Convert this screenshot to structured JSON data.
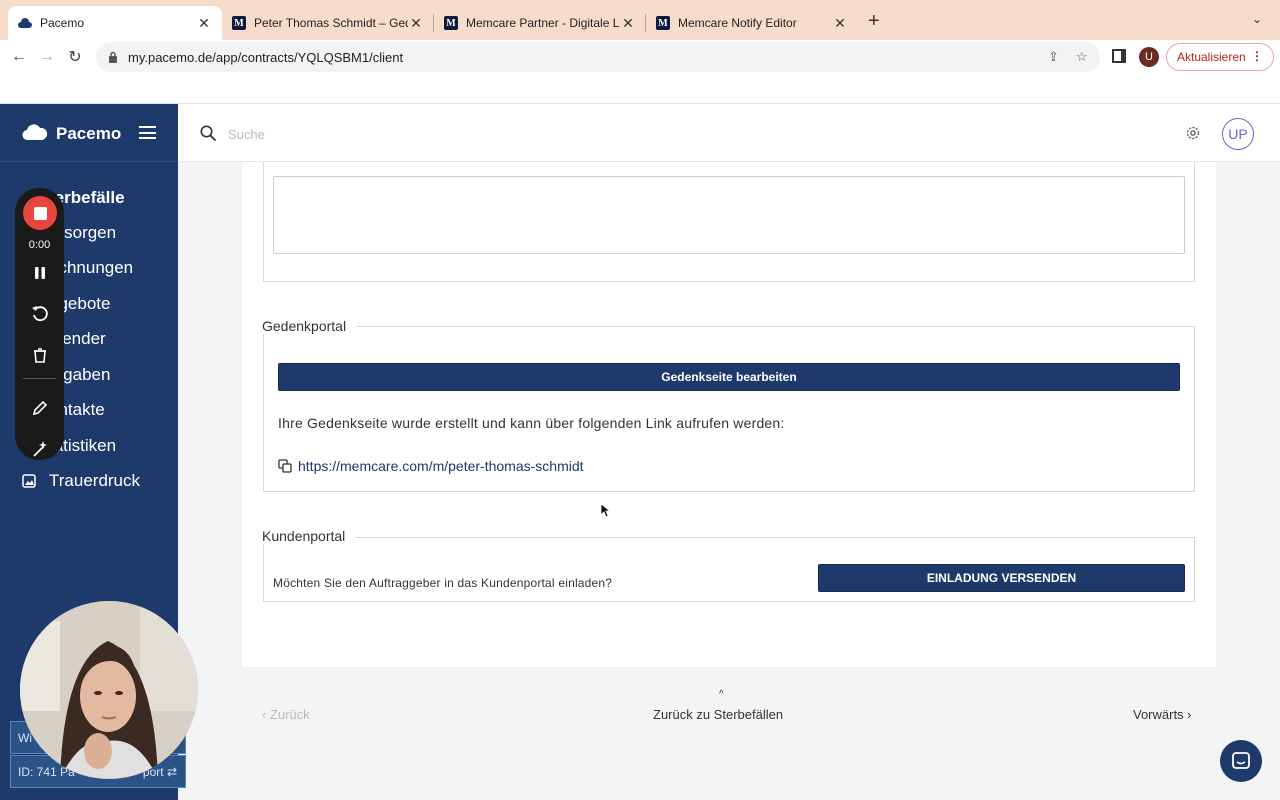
{
  "browser": {
    "tabs": [
      {
        "title": "Pacemo",
        "favicon": "pacemo-cloud",
        "active": true
      },
      {
        "title": "Peter Thomas Schmidt – Gede",
        "favicon": "M"
      },
      {
        "title": "Memcare Partner - Digitale Lös",
        "favicon": "M"
      },
      {
        "title": "Memcare Notify Editor",
        "favicon": "M"
      }
    ],
    "url": "my.pacemo.de/app/contracts/YQLQSBM1/client",
    "profile_initial": "U",
    "update_label": "Aktualisieren"
  },
  "app": {
    "brand": "Pacemo",
    "search_placeholder": "Suche",
    "avatar_initials": "UP",
    "sidebar": [
      {
        "label": "Sterbefälle",
        "icon": "cross-icon"
      },
      {
        "label": "Vorsorgen",
        "icon": "folder-icon"
      },
      {
        "label": "Rechnungen",
        "icon": "invoice-icon"
      },
      {
        "label": "Angebote",
        "icon": "offer-icon"
      },
      {
        "label": "Kalender",
        "icon": "calendar-icon"
      },
      {
        "label": "Aufgaben",
        "icon": "tasks-icon"
      },
      {
        "label": "Kontakte",
        "icon": "contacts-icon"
      },
      {
        "label": "Statistiken",
        "icon": "chart-icon"
      },
      {
        "label": "Trauerdruck",
        "icon": "image-icon"
      }
    ],
    "sidebar_visible": [
      "terbefälle",
      "orsorgen",
      "echnungen",
      "ngebote",
      "alender",
      "ufgaben",
      "ontakte",
      "tatistiken",
      "Trauerdruck"
    ],
    "id_box": {
      "line1": "Wi",
      "line2": "ID: 741 Pa",
      "line2_tail": "port"
    }
  },
  "main": {
    "gedenkportal": {
      "legend": "Gedenkportal",
      "button": "Gedenkseite bearbeiten",
      "text": "Ihre Gedenkseite wurde erstellt und kann über folgenden Link aufrufen werden:",
      "link": "https://memcare.com/m/peter-thomas-schmidt"
    },
    "kundenportal": {
      "legend": "Kundenportal",
      "question": "Möchten Sie den Auftraggeber in das Kundenportal einladen?",
      "button": "EINLADUNG VERSENDEN"
    },
    "pager": {
      "prev": "‹ Zurück",
      "up": "Zurück zu Sterbefällen",
      "next": "Vorwärts ›"
    }
  },
  "recorder": {
    "time": "0:00"
  },
  "colors": {
    "brand": "#1d3a6b",
    "record": "#e8453c",
    "avatar": "#6b62c9"
  }
}
